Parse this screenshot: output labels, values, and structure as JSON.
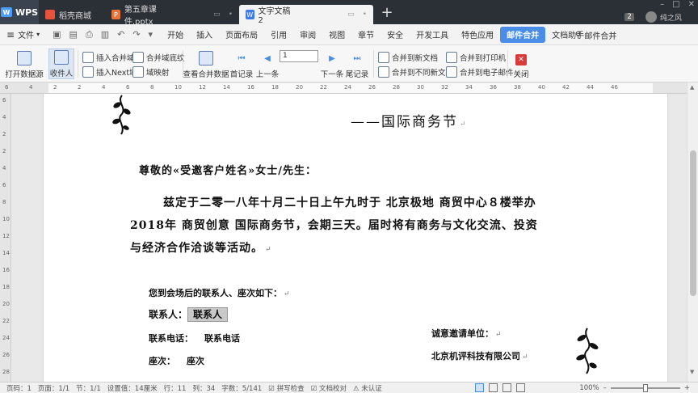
{
  "titlebar": {
    "app_tab": "WPS",
    "tabs": [
      {
        "label": "稻壳商城",
        "color": "#e8523c"
      },
      {
        "label": "第五章课件.pptx",
        "color": "#e8763c"
      },
      {
        "label": "文字文稿2",
        "color": "#3d7be8"
      }
    ],
    "new_tab": "+",
    "badge": "2",
    "user": "纯之风"
  },
  "menubar": {
    "file": "文件",
    "items": [
      "开始",
      "插入",
      "页面布局",
      "引用",
      "审阅",
      "视图",
      "章节",
      "安全",
      "开发工具",
      "特色应用",
      "邮件合并",
      "文档助手"
    ],
    "active": "邮件合并",
    "search_label": "邮件合并"
  },
  "ribbon": {
    "open_source": "打开数据源",
    "recipients": "收件人",
    "insert_merge_field": "插入合并域",
    "insert_next_field": "插入Next域",
    "merge_field_shading": "合并域底纹",
    "field_mapping": "域映射",
    "view_merged_data": "查看合并数据",
    "first_record": "首记录",
    "prev": "上一条",
    "record_value": "1",
    "next": "下一条",
    "last_record": "尾记录",
    "merge_new_doc": "合并到新文档",
    "merge_diff_doc": "合并到不同新文档",
    "merge_printer": "合并到打印机",
    "merge_email": "合并到电子邮件",
    "close": "关闭"
  },
  "ruler": {
    "h_numbers": [
      "6",
      "4",
      "2",
      "2",
      "4",
      "6",
      "8",
      "10",
      "12",
      "14",
      "16",
      "18",
      "20",
      "22",
      "24",
      "26",
      "28",
      "30",
      "32",
      "34",
      "36",
      "38",
      "40",
      "42",
      "44",
      "46"
    ],
    "v_numbers": [
      "6",
      "4",
      "2",
      "2",
      "4",
      "6",
      "8",
      "10",
      "12",
      "14",
      "16",
      "18",
      "20",
      "22",
      "24",
      "26",
      "28"
    ]
  },
  "document": {
    "heading": "——国际商务节",
    "salutation": "尊敬的«受邀客户姓名»女士/先生：",
    "body_line1": "兹定于二零一八年十月二十日上午九时于 北京极地 商贸中心８楼举办",
    "body_line2": "2018年 商贸创意 国际商务节，会期三天。届时将有商务与文化交流、投资",
    "body_line3": "与经济合作洽谈等活动。",
    "contact_intro": "您到会场后的联系人、座次如下：",
    "contact_label": "联系人：",
    "contact_value": "联系人",
    "phone_label": "联系电话：",
    "phone_value": "联系电话",
    "seat_label": "座次：",
    "seat_value": "座次",
    "inviter_label": "诚意邀请单位：",
    "inviter_name": "北京机评科技有限公司",
    "para_mark": "↵"
  },
  "statusbar": {
    "page_num": "页码：1",
    "page": "页面：1/1",
    "section": "节：1/1",
    "position": "设置值：14厘米",
    "row": "行：11",
    "col": "列：34",
    "words": "字数：5/141",
    "spell": "拼写检查",
    "proof": "文档校对",
    "cert": "未认证",
    "zoom": "100%",
    "zoom_level": 0.5
  }
}
